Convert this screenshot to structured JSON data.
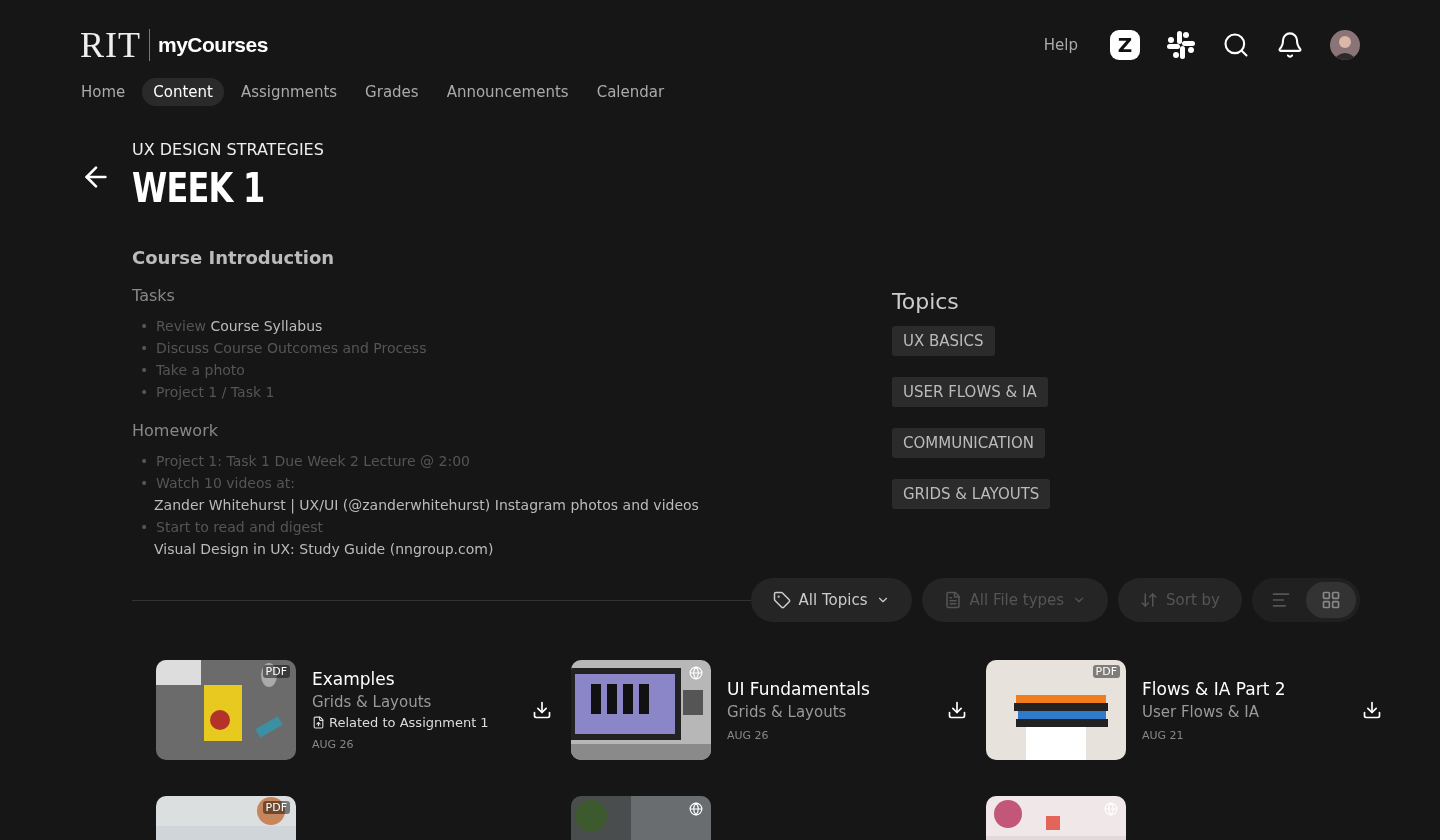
{
  "brand": {
    "logo": "RIT",
    "product": "myCourses"
  },
  "header": {
    "help": "Help",
    "zoom_letter": "Z"
  },
  "nav": [
    {
      "label": "Home",
      "selected": false
    },
    {
      "label": "Content",
      "selected": true
    },
    {
      "label": "Assignments",
      "selected": false
    },
    {
      "label": "Grades",
      "selected": false
    },
    {
      "label": "Announcements",
      "selected": false
    },
    {
      "label": "Calendar",
      "selected": false
    }
  ],
  "course": "UX DESIGN STRATEGIES",
  "title": "WEEK 1",
  "intro": {
    "heading": "Course Introduction",
    "bullet": "•",
    "sections": [
      {
        "heading": "Tasks",
        "items": [
          {
            "text": "Review **Course Syllabus**"
          },
          {
            "text": "Discuss Course Outcomes and Process"
          },
          {
            "text": "Take a photo"
          },
          {
            "text": "Project 1 / Task 1"
          }
        ]
      },
      {
        "heading": "Homework",
        "items": [
          {
            "text": "Project 1: Task 1 Due Week 2 Lecture @ 2:00"
          },
          {
            "text": "Watch 10 videos at:",
            "link": "Zander Whitehurst | UX/UI (@zanderwhitehurst) Instagram photos and videos"
          },
          {
            "text": "Start to read and digest",
            "link": "Visual Design in UX: Study Guide (nngroup.com)"
          }
        ]
      }
    ]
  },
  "topics": {
    "heading": "Topics",
    "tags": [
      "UX BASICS",
      "USER FLOWS & IA",
      "COMMUNICATION",
      "GRIDS & LAYOUTS"
    ]
  },
  "filters": {
    "topics": "All Topics",
    "file_types": "All File types",
    "sort": "Sort by",
    "view": [
      {
        "kind": "list",
        "selected": false
      },
      {
        "kind": "grid",
        "selected": true
      }
    ]
  },
  "files": [
    {
      "kind": "pdf",
      "badge": "PDF",
      "title": "Examples",
      "topic": "Grids & Layouts",
      "related": "Related to Assignment 1",
      "date": "AUG 26"
    },
    {
      "kind": "web",
      "title": "UI Fundamentals",
      "topic": "Grids & Layouts",
      "date": "AUG 26"
    },
    {
      "kind": "pdf",
      "badge": "PDF",
      "title": "Flows & IA Part 2",
      "topic": "User Flows & IA",
      "date": "AUG 21"
    },
    {
      "kind": "pdf",
      "badge": "PDF"
    },
    {
      "kind": "web"
    },
    {
      "kind": "web"
    }
  ]
}
